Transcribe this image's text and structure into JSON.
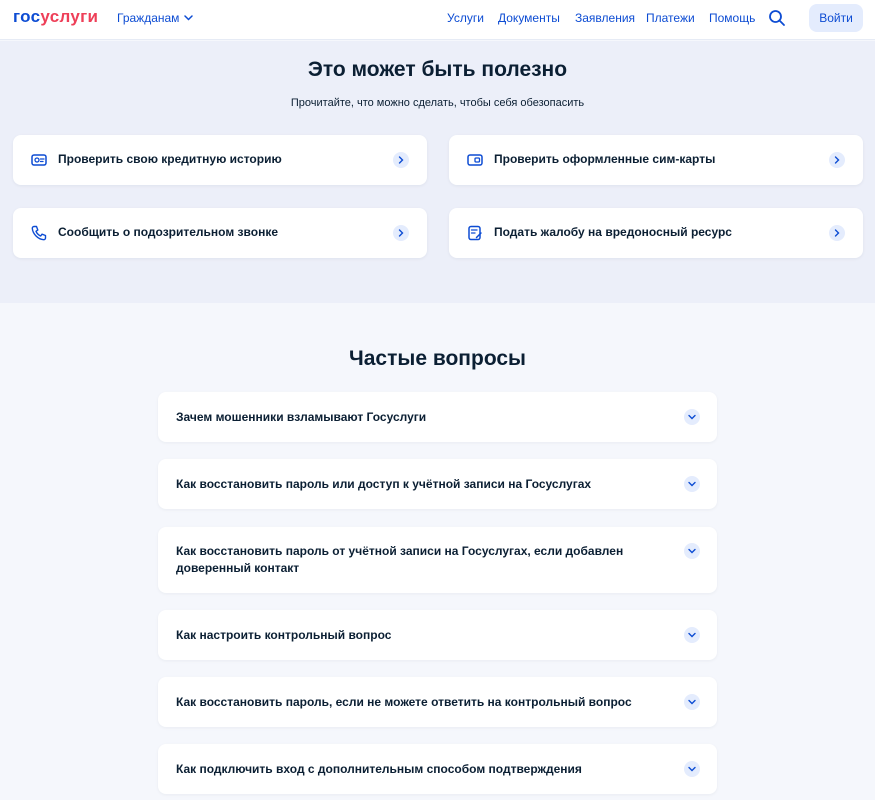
{
  "header": {
    "logo_part1": "гос",
    "logo_part2": "услуги",
    "citizens_label": "Гражданам",
    "nav": [
      "Услуги",
      "Документы",
      "Заявления",
      "Платежи",
      "Помощь"
    ],
    "login_label": "Войти"
  },
  "useful": {
    "title": "Это может быть полезно",
    "subtitle": "Прочитайте, что можно сделать, чтобы себя обезопасить",
    "cards": [
      {
        "label": "Проверить свою кредитную историю",
        "icon": "credit-history-icon"
      },
      {
        "label": "Проверить оформленные сим-карты",
        "icon": "sim-card-icon"
      },
      {
        "label": "Сообщить о подозрительном звонке",
        "icon": "phone-icon"
      },
      {
        "label": "Подать жалобу на вредоносный ресурс",
        "icon": "complaint-icon"
      }
    ]
  },
  "faq": {
    "title": "Частые вопросы",
    "items": [
      "Зачем мошенники взламывают Госуслуги",
      "Как восстановить пароль или доступ к учётной записи на Госуслугах",
      "Как восстановить пароль от учётной записи на Госуслугах, если добавлен доверенный контакт",
      "Как настроить контрольный вопрос",
      "Как восстановить пароль, если не можете ответить на контрольный вопрос",
      "Как подключить вход с дополнительным способом подтверждения"
    ]
  },
  "colors": {
    "brand_blue": "#0d4cd3",
    "brand_red": "#ee3f58",
    "section_bg": "#eceff9",
    "page_bg": "#f5f7fc",
    "chip_bg": "#e4ecfd"
  }
}
